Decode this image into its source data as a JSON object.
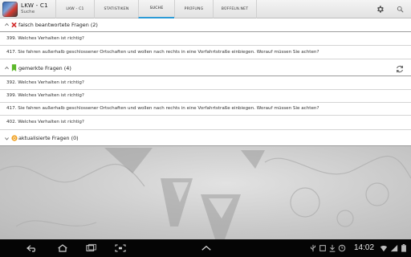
{
  "app": {
    "title": "LKW - C1",
    "subtitle": "Suche"
  },
  "tabs": [
    {
      "label": "LKW - C1",
      "active": false
    },
    {
      "label": "STATISTIKEN",
      "active": false
    },
    {
      "label": "SUCHE",
      "active": true
    },
    {
      "label": "PRÜFUNG",
      "active": false
    },
    {
      "label": "BÜFFELN.NET",
      "active": false
    }
  ],
  "toolbar_icons": [
    "settings-gear-icon",
    "search-icon"
  ],
  "sections": [
    {
      "title": "falsch beantwortete Fragen (2)",
      "icon": "red-x-icon",
      "expanded": true,
      "items": [
        "399. Welches Verhalten ist richtig?",
        "417. Sie fahren außerhalb geschlossener Ortschaften und wollen nach rechts in eine Vorfahrtstraße einbiegen. Worauf müssen Sie achten?"
      ]
    },
    {
      "title": "gemerkte Fragen (4)",
      "icon": "green-bookmark-icon",
      "expanded": true,
      "items": [
        "392. Welches Verhalten ist richtig?",
        "399. Welches Verhalten ist richtig?",
        "417. Sie fahren außerhalb geschlossener Ortschaften und wollen nach rechts in eine Vorfahrtstraße einbiegen. Worauf müssen Sie achten?",
        "402. Welches Verhalten ist richtig?"
      ]
    },
    {
      "title": "aktualisierte Fragen (0)",
      "icon": "orange-refresh-icon",
      "expanded": false,
      "items": []
    }
  ],
  "statusbar": {
    "time": "14:02"
  },
  "colors": {
    "accent": "#2b9ad6",
    "error": "#d32f2f",
    "bookmark": "#5cb82a",
    "update": "#f0a020"
  }
}
